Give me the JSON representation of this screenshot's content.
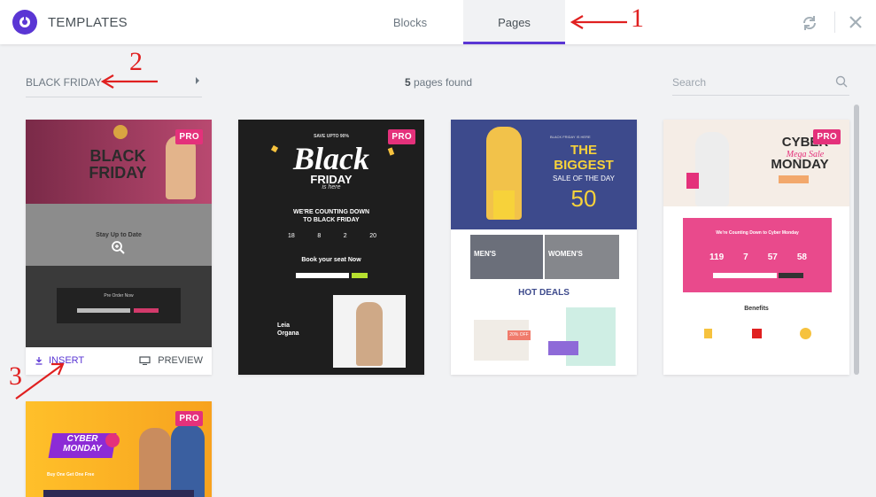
{
  "header": {
    "brand": "TEMPLATES",
    "tabs": [
      {
        "label": "Blocks",
        "active": false
      },
      {
        "label": "Pages",
        "active": true
      }
    ],
    "icons": [
      "logo-icon",
      "sync-icon",
      "close-icon"
    ]
  },
  "toolbar": {
    "category_label": "BLACK FRIDAY",
    "count_number": "5",
    "count_text": "pages found",
    "search_placeholder": "Search"
  },
  "colors": {
    "accent": "#5a36d4",
    "pro_badge": "#e4317b",
    "annotation": "#e02020"
  },
  "cards": [
    {
      "pro": "PRO",
      "insert_label": "INSERT",
      "preview_label": "PREVIEW",
      "texts": {
        "t1": "BLACK",
        "t2": "FRIDAY",
        "t3": "Stay Up to Date",
        "t4": "Pre Order Now"
      }
    },
    {
      "pro": "PRO",
      "texts": {
        "t1": "SAVE UPTO 90%",
        "t2": "Black",
        "t3": "FRIDAY",
        "t4": "is here",
        "t5": "WE'RE COUNTING DOWN",
        "t6": "TO BLACK FRIDAY",
        "c1": "18",
        "c2": "8",
        "c3": "2",
        "c4": "20",
        "t7": "Book your seat Now",
        "t8": "Leia",
        "t9": "Organa"
      }
    },
    {
      "texts": {
        "t1": "BLACK FRIDAY IS HERE",
        "t2": "THE",
        "t3": "BIGGEST",
        "t4": "SALE OF THE DAY",
        "t5": "50",
        "t6": "MEN'S",
        "t7": "WOMEN'S",
        "t8": "HOT DEALS",
        "t9": "20% OFF"
      }
    },
    {
      "pro": "PRO",
      "texts": {
        "t1": "CYBER",
        "t2": "Mega Sale",
        "t3": "MONDAY",
        "t4": "We're Counting Down to Cyber Monday",
        "c1": "119",
        "c2": "7",
        "c3": "57",
        "c4": "58",
        "t5": "Benefits"
      }
    },
    {
      "pro": "PRO",
      "texts": {
        "t1": "CYBER",
        "t2": "MONDAY",
        "t3": "Buy One Get One Free"
      }
    }
  ],
  "annotations": [
    "1",
    "2",
    "3"
  ]
}
